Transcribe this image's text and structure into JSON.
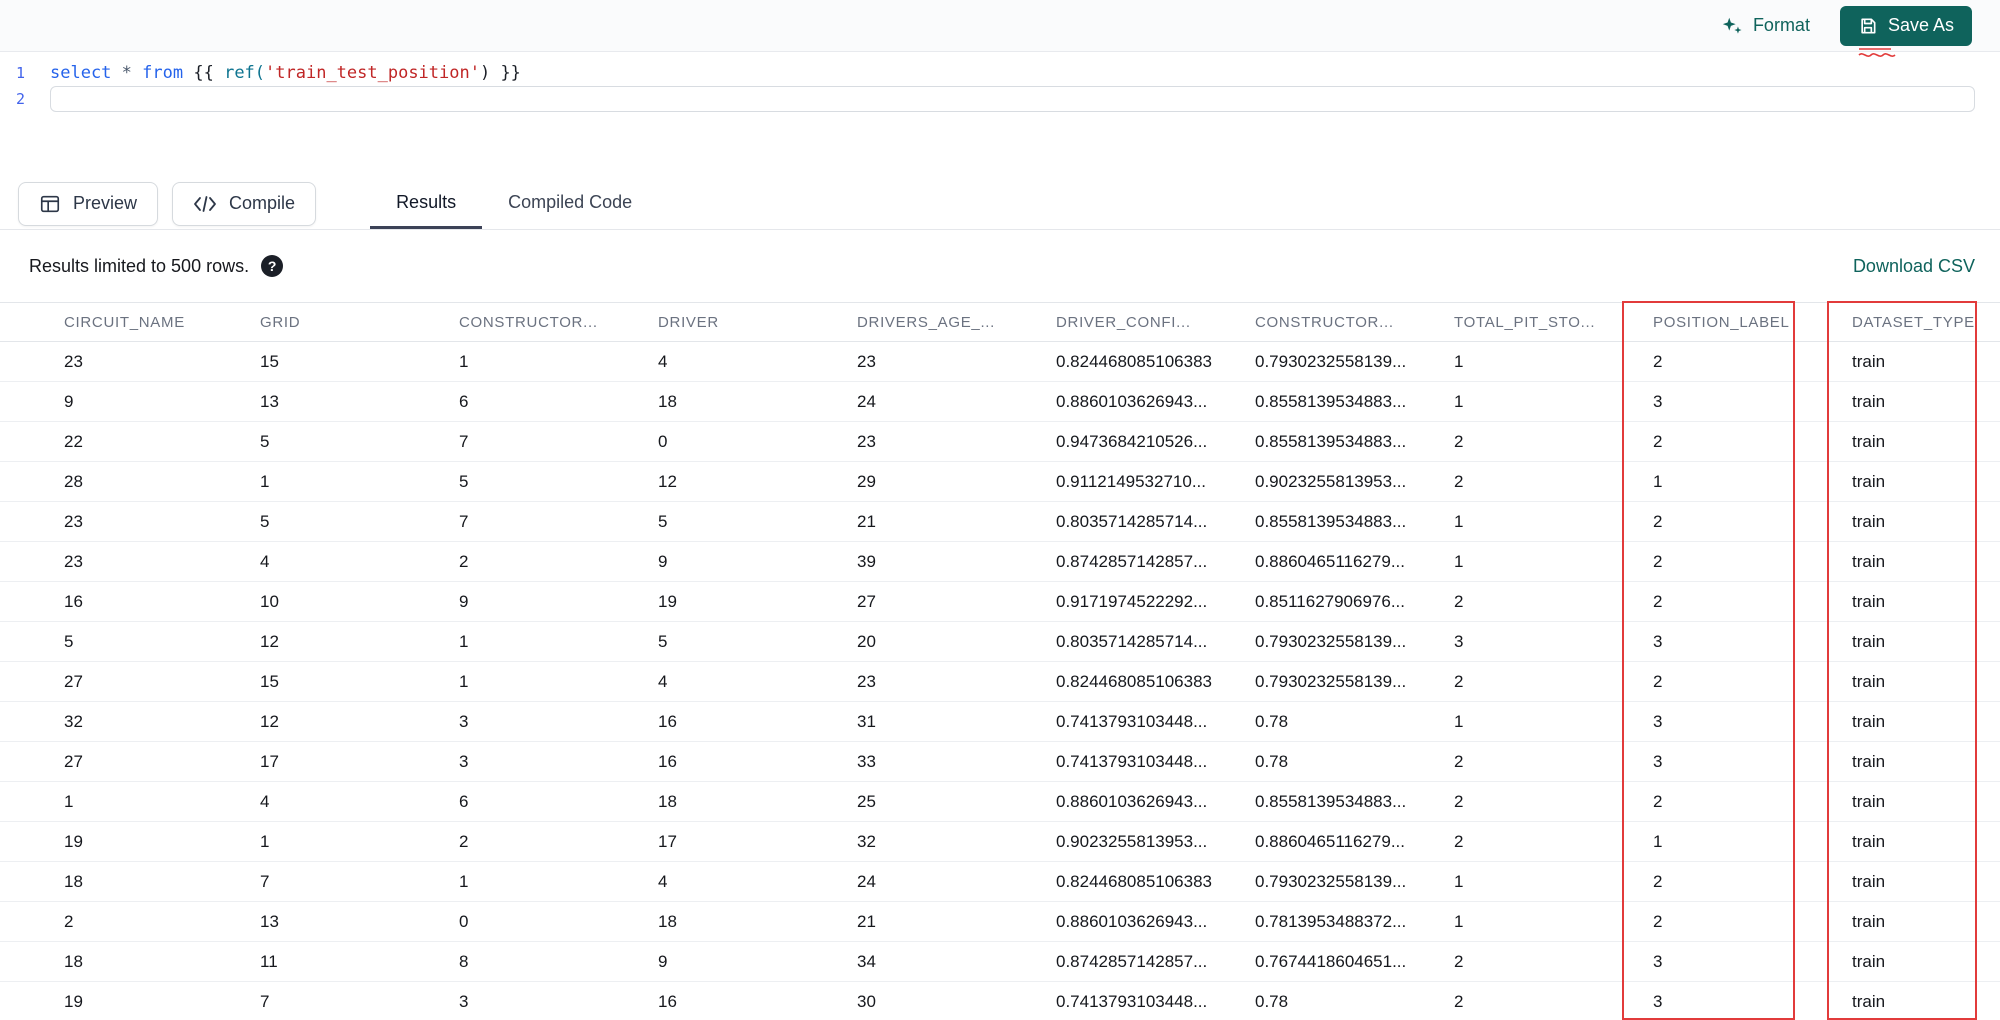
{
  "toolbar": {
    "format_label": "Format",
    "save_as_label": "Save As"
  },
  "editor": {
    "line_numbers": [
      "1",
      "2"
    ],
    "line1_tokens": [
      {
        "text": "select",
        "type": "keyword"
      },
      {
        "text": " ",
        "type": "plain"
      },
      {
        "text": "*",
        "type": "operator"
      },
      {
        "text": " ",
        "type": "plain"
      },
      {
        "text": "from",
        "type": "keyword"
      },
      {
        "text": " {{ ",
        "type": "plain"
      },
      {
        "text": "ref(",
        "type": "function"
      },
      {
        "text": "'train_test_position'",
        "type": "string"
      },
      {
        "text": ") }}",
        "type": "plain"
      }
    ]
  },
  "controls": {
    "preview_label": "Preview",
    "compile_label": "Compile"
  },
  "tabs": [
    {
      "label": "Results",
      "active": true
    },
    {
      "label": "Compiled Code",
      "active": false
    }
  ],
  "results_bar": {
    "limit_text": "Results limited to 500 rows.",
    "download_csv_label": "Download CSV"
  },
  "table": {
    "columns": [
      "CIRCUIT_NAME",
      "GRID",
      "CONSTRUCTOR...",
      "DRIVER",
      "DRIVERS_AGE_...",
      "DRIVER_CONFI...",
      "CONSTRUCTOR...",
      "TOTAL_PIT_STO...",
      "POSITION_LABEL",
      "DATASET_TYPE"
    ],
    "rows": [
      [
        "23",
        "15",
        "1",
        "4",
        "23",
        "0.824468085106383",
        "0.7930232558139...",
        "1",
        "2",
        "train"
      ],
      [
        "9",
        "13",
        "6",
        "18",
        "24",
        "0.8860103626943...",
        "0.8558139534883...",
        "1",
        "3",
        "train"
      ],
      [
        "22",
        "5",
        "7",
        "0",
        "23",
        "0.9473684210526...",
        "0.8558139534883...",
        "2",
        "2",
        "train"
      ],
      [
        "28",
        "1",
        "5",
        "12",
        "29",
        "0.9112149532710...",
        "0.9023255813953...",
        "2",
        "1",
        "train"
      ],
      [
        "23",
        "5",
        "7",
        "5",
        "21",
        "0.8035714285714...",
        "0.8558139534883...",
        "1",
        "2",
        "train"
      ],
      [
        "23",
        "4",
        "2",
        "9",
        "39",
        "0.8742857142857...",
        "0.8860465116279...",
        "1",
        "2",
        "train"
      ],
      [
        "16",
        "10",
        "9",
        "19",
        "27",
        "0.9171974522292...",
        "0.8511627906976...",
        "2",
        "2",
        "train"
      ],
      [
        "5",
        "12",
        "1",
        "5",
        "20",
        "0.8035714285714...",
        "0.7930232558139...",
        "3",
        "3",
        "train"
      ],
      [
        "27",
        "15",
        "1",
        "4",
        "23",
        "0.824468085106383",
        "0.7930232558139...",
        "2",
        "2",
        "train"
      ],
      [
        "32",
        "12",
        "3",
        "16",
        "31",
        "0.7413793103448...",
        "0.78",
        "1",
        "3",
        "train"
      ],
      [
        "27",
        "17",
        "3",
        "16",
        "33",
        "0.7413793103448...",
        "0.78",
        "2",
        "3",
        "train"
      ],
      [
        "1",
        "4",
        "6",
        "18",
        "25",
        "0.8860103626943...",
        "0.8558139534883...",
        "2",
        "2",
        "train"
      ],
      [
        "19",
        "1",
        "2",
        "17",
        "32",
        "0.9023255813953...",
        "0.8860465116279...",
        "2",
        "1",
        "train"
      ],
      [
        "18",
        "7",
        "1",
        "4",
        "24",
        "0.824468085106383",
        "0.7930232558139...",
        "1",
        "2",
        "train"
      ],
      [
        "2",
        "13",
        "0",
        "18",
        "21",
        "0.8860103626943...",
        "0.7813953488372...",
        "1",
        "2",
        "train"
      ],
      [
        "18",
        "11",
        "8",
        "9",
        "34",
        "0.8742857142857...",
        "0.7674418604651...",
        "2",
        "3",
        "train"
      ],
      [
        "19",
        "7",
        "3",
        "16",
        "30",
        "0.7413793103448...",
        "0.78",
        "2",
        "3",
        "train"
      ]
    ]
  },
  "annotations": {
    "highlighted_columns": [
      "POSITION_LABEL",
      "DATASET_TYPE"
    ],
    "highlight_color": "#e23b3b"
  },
  "colors": {
    "accent_teal": "#0f635c",
    "keyword_blue": "#2563eb",
    "string_red": "#c02626"
  }
}
